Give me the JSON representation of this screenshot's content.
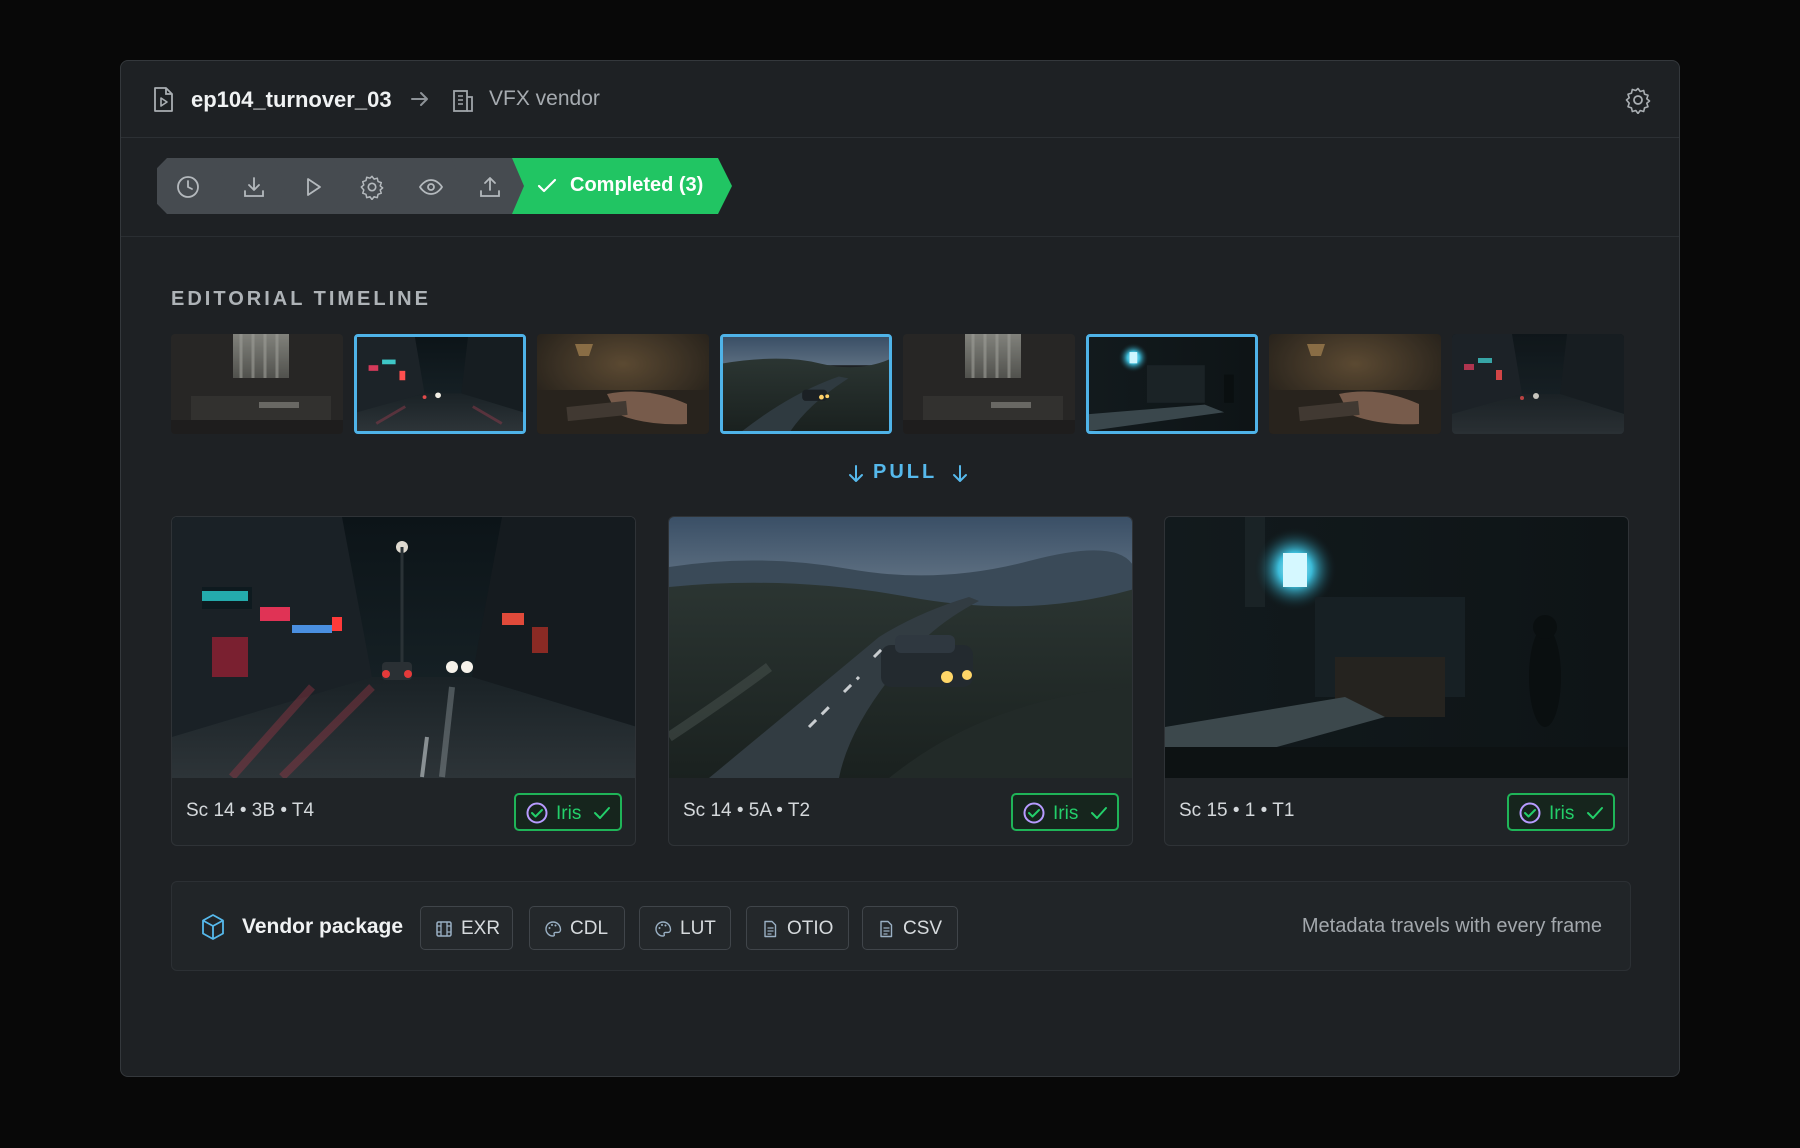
{
  "header": {
    "file_name": "ep104_turnover_03",
    "destination": "VFX vendor",
    "icons": [
      "file-play-icon",
      "arrow-right-icon",
      "building-icon",
      "gear-icon"
    ]
  },
  "stepper": {
    "steps": [
      {
        "icon": "clock-icon"
      },
      {
        "icon": "download-icon"
      },
      {
        "icon": "play-icon"
      },
      {
        "icon": "gear-icon"
      },
      {
        "icon": "eye-icon"
      },
      {
        "icon": "upload-icon"
      }
    ],
    "completed_label": "Completed (3)",
    "completed_color": "#21c563"
  },
  "timeline": {
    "title": "EDITORIAL TIMELINE",
    "selected_color": "#4fb3e8",
    "thumbnails": [
      {
        "scene": "interior-window",
        "selected": false
      },
      {
        "scene": "rainy-street",
        "selected": true
      },
      {
        "scene": "desk-hands",
        "selected": false
      },
      {
        "scene": "country-road",
        "selected": true
      },
      {
        "scene": "interior-window",
        "selected": false
      },
      {
        "scene": "dark-interior",
        "selected": true
      },
      {
        "scene": "desk-hands",
        "selected": false
      },
      {
        "scene": "rainy-street",
        "selected": false
      }
    ]
  },
  "pull": {
    "label": "PULL",
    "icon": "arrow-down-icon"
  },
  "shots": [
    {
      "label": "Sc 14 • 3B • T4",
      "badge": "Iris",
      "scene": "rainy-street"
    },
    {
      "label": "Sc 14 • 5A • T2",
      "badge": "Iris",
      "scene": "country-road"
    },
    {
      "label": "Sc 15 • 1 • T1",
      "badge": "Iris",
      "scene": "dark-interior"
    }
  ],
  "vendor_package": {
    "title": "Vendor package",
    "formats": [
      {
        "label": "EXR",
        "icon": "film-icon"
      },
      {
        "label": "CDL",
        "icon": "palette-icon"
      },
      {
        "label": "LUT",
        "icon": "palette-icon"
      },
      {
        "label": "OTIO",
        "icon": "document-icon"
      },
      {
        "label": "CSV",
        "icon": "document-icon"
      }
    ],
    "note": "Metadata travels with every frame"
  }
}
